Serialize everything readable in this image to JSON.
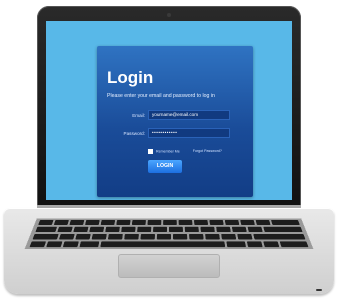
{
  "login": {
    "title": "Login",
    "subtitle": "Please enter your email and password to log in",
    "email_label": "Email:",
    "email_value": "yourname@email.com",
    "password_label": "Password:",
    "password_value": "••••••••••••",
    "remember_label": "Remember Me",
    "forgot_label": "Forgot Password?",
    "login_button": "LOGIN"
  },
  "colors": {
    "screen_background": "#58b8e8",
    "panel": "#1a4c99",
    "button": "#2a86f0"
  }
}
